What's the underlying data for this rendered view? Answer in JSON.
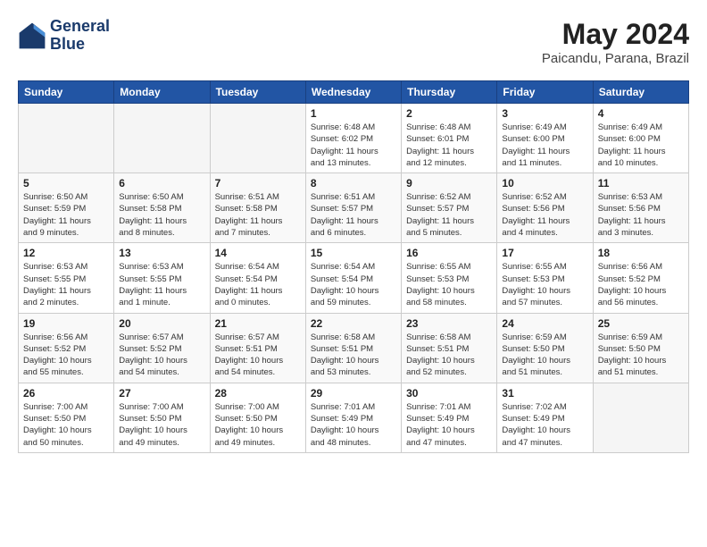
{
  "header": {
    "logo": {
      "line1": "General",
      "line2": "Blue"
    },
    "title": "May 2024",
    "location": "Paicandu, Parana, Brazil"
  },
  "weekdays": [
    "Sunday",
    "Monday",
    "Tuesday",
    "Wednesday",
    "Thursday",
    "Friday",
    "Saturday"
  ],
  "weeks": [
    [
      {
        "day": "",
        "info": ""
      },
      {
        "day": "",
        "info": ""
      },
      {
        "day": "",
        "info": ""
      },
      {
        "day": "1",
        "info": "Sunrise: 6:48 AM\nSunset: 6:02 PM\nDaylight: 11 hours\nand 13 minutes."
      },
      {
        "day": "2",
        "info": "Sunrise: 6:48 AM\nSunset: 6:01 PM\nDaylight: 11 hours\nand 12 minutes."
      },
      {
        "day": "3",
        "info": "Sunrise: 6:49 AM\nSunset: 6:00 PM\nDaylight: 11 hours\nand 11 minutes."
      },
      {
        "day": "4",
        "info": "Sunrise: 6:49 AM\nSunset: 6:00 PM\nDaylight: 11 hours\nand 10 minutes."
      }
    ],
    [
      {
        "day": "5",
        "info": "Sunrise: 6:50 AM\nSunset: 5:59 PM\nDaylight: 11 hours\nand 9 minutes."
      },
      {
        "day": "6",
        "info": "Sunrise: 6:50 AM\nSunset: 5:58 PM\nDaylight: 11 hours\nand 8 minutes."
      },
      {
        "day": "7",
        "info": "Sunrise: 6:51 AM\nSunset: 5:58 PM\nDaylight: 11 hours\nand 7 minutes."
      },
      {
        "day": "8",
        "info": "Sunrise: 6:51 AM\nSunset: 5:57 PM\nDaylight: 11 hours\nand 6 minutes."
      },
      {
        "day": "9",
        "info": "Sunrise: 6:52 AM\nSunset: 5:57 PM\nDaylight: 11 hours\nand 5 minutes."
      },
      {
        "day": "10",
        "info": "Sunrise: 6:52 AM\nSunset: 5:56 PM\nDaylight: 11 hours\nand 4 minutes."
      },
      {
        "day": "11",
        "info": "Sunrise: 6:53 AM\nSunset: 5:56 PM\nDaylight: 11 hours\nand 3 minutes."
      }
    ],
    [
      {
        "day": "12",
        "info": "Sunrise: 6:53 AM\nSunset: 5:55 PM\nDaylight: 11 hours\nand 2 minutes."
      },
      {
        "day": "13",
        "info": "Sunrise: 6:53 AM\nSunset: 5:55 PM\nDaylight: 11 hours\nand 1 minute."
      },
      {
        "day": "14",
        "info": "Sunrise: 6:54 AM\nSunset: 5:54 PM\nDaylight: 11 hours\nand 0 minutes."
      },
      {
        "day": "15",
        "info": "Sunrise: 6:54 AM\nSunset: 5:54 PM\nDaylight: 10 hours\nand 59 minutes."
      },
      {
        "day": "16",
        "info": "Sunrise: 6:55 AM\nSunset: 5:53 PM\nDaylight: 10 hours\nand 58 minutes."
      },
      {
        "day": "17",
        "info": "Sunrise: 6:55 AM\nSunset: 5:53 PM\nDaylight: 10 hours\nand 57 minutes."
      },
      {
        "day": "18",
        "info": "Sunrise: 6:56 AM\nSunset: 5:52 PM\nDaylight: 10 hours\nand 56 minutes."
      }
    ],
    [
      {
        "day": "19",
        "info": "Sunrise: 6:56 AM\nSunset: 5:52 PM\nDaylight: 10 hours\nand 55 minutes."
      },
      {
        "day": "20",
        "info": "Sunrise: 6:57 AM\nSunset: 5:52 PM\nDaylight: 10 hours\nand 54 minutes."
      },
      {
        "day": "21",
        "info": "Sunrise: 6:57 AM\nSunset: 5:51 PM\nDaylight: 10 hours\nand 54 minutes."
      },
      {
        "day": "22",
        "info": "Sunrise: 6:58 AM\nSunset: 5:51 PM\nDaylight: 10 hours\nand 53 minutes."
      },
      {
        "day": "23",
        "info": "Sunrise: 6:58 AM\nSunset: 5:51 PM\nDaylight: 10 hours\nand 52 minutes."
      },
      {
        "day": "24",
        "info": "Sunrise: 6:59 AM\nSunset: 5:50 PM\nDaylight: 10 hours\nand 51 minutes."
      },
      {
        "day": "25",
        "info": "Sunrise: 6:59 AM\nSunset: 5:50 PM\nDaylight: 10 hours\nand 51 minutes."
      }
    ],
    [
      {
        "day": "26",
        "info": "Sunrise: 7:00 AM\nSunset: 5:50 PM\nDaylight: 10 hours\nand 50 minutes."
      },
      {
        "day": "27",
        "info": "Sunrise: 7:00 AM\nSunset: 5:50 PM\nDaylight: 10 hours\nand 49 minutes."
      },
      {
        "day": "28",
        "info": "Sunrise: 7:00 AM\nSunset: 5:50 PM\nDaylight: 10 hours\nand 49 minutes."
      },
      {
        "day": "29",
        "info": "Sunrise: 7:01 AM\nSunset: 5:49 PM\nDaylight: 10 hours\nand 48 minutes."
      },
      {
        "day": "30",
        "info": "Sunrise: 7:01 AM\nSunset: 5:49 PM\nDaylight: 10 hours\nand 47 minutes."
      },
      {
        "day": "31",
        "info": "Sunrise: 7:02 AM\nSunset: 5:49 PM\nDaylight: 10 hours\nand 47 minutes."
      },
      {
        "day": "",
        "info": ""
      }
    ]
  ]
}
